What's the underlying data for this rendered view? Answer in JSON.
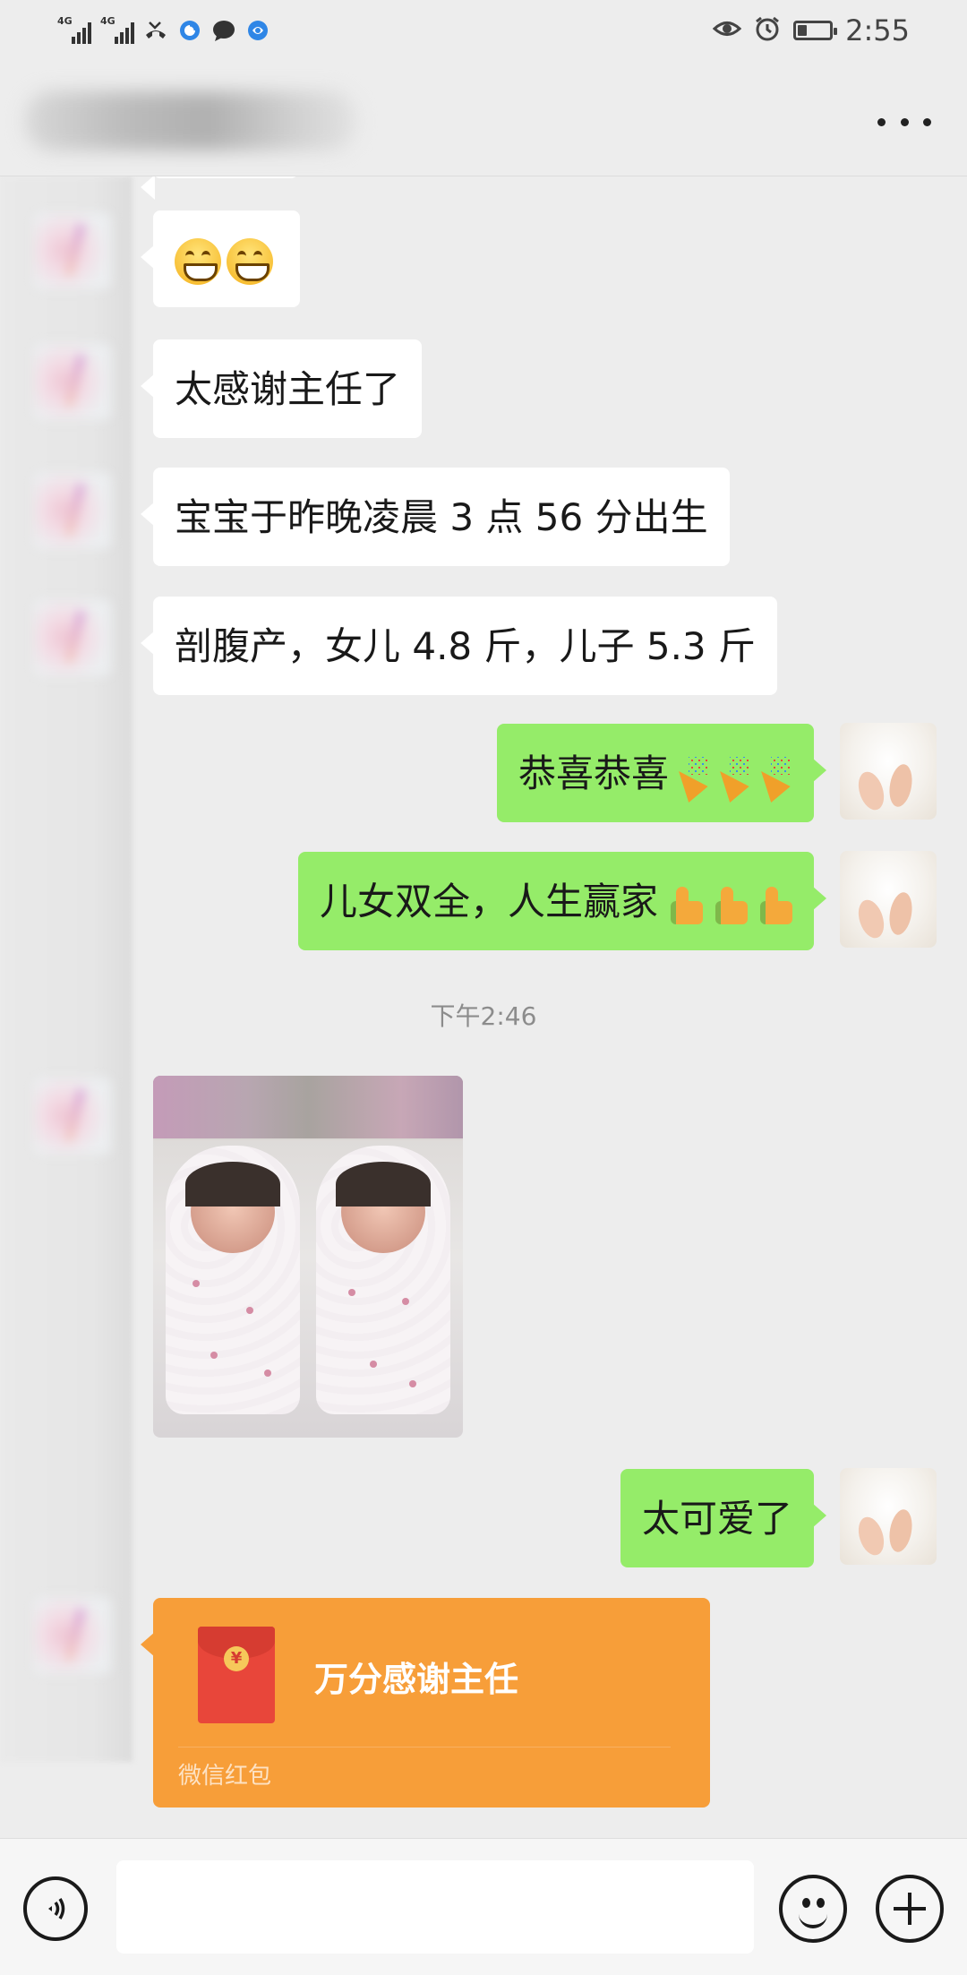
{
  "status_bar": {
    "signal_1": "4G",
    "signal_2": "4G",
    "time": "2:55",
    "battery_level": 0.3,
    "icons": [
      "signal-icon",
      "signal-icon",
      "missed-call-icon",
      "browser-icon",
      "message-icon",
      "app-icon",
      "eye-icon",
      "alarm-icon",
      "battery-icon"
    ]
  },
  "header": {
    "title": "",
    "more_icon": "more-dots-icon"
  },
  "messages": [
    {
      "side": "left",
      "type": "emoji",
      "emojis": [
        "grin",
        "grin"
      ]
    },
    {
      "side": "left",
      "type": "text",
      "text": "太感谢主任了"
    },
    {
      "side": "left",
      "type": "text",
      "text": "宝宝于昨晚凌晨 3 点 56 分出生"
    },
    {
      "side": "left",
      "type": "text",
      "text": "剖腹产，女儿 4.8 斤，儿子 5.3 斤"
    },
    {
      "side": "right",
      "type": "text",
      "text": "恭喜恭喜",
      "emojis": [
        "party-popper",
        "party-popper",
        "party-popper"
      ]
    },
    {
      "side": "right",
      "type": "text",
      "text": "儿女双全，人生赢家",
      "emojis": [
        "thumbs-up",
        "thumbs-up",
        "thumbs-up"
      ]
    },
    {
      "type": "timestamp",
      "text": "下午2:46"
    },
    {
      "side": "left",
      "type": "image",
      "alt": "twin newborn babies photo"
    },
    {
      "side": "right",
      "type": "text",
      "text": "太可爱了"
    },
    {
      "side": "left",
      "type": "red_packet",
      "title": "万分感谢主任",
      "footer": "微信红包",
      "coin": "¥"
    }
  ],
  "colors": {
    "background": "#ededed",
    "bubble_self": "#95ec69",
    "bubble_other": "#ffffff",
    "red_packet": "#f79e39"
  },
  "input_bar": {
    "voice_icon": "voice-icon",
    "input_value": "",
    "emoji_icon": "emoji-icon",
    "plus_icon": "plus-icon"
  }
}
